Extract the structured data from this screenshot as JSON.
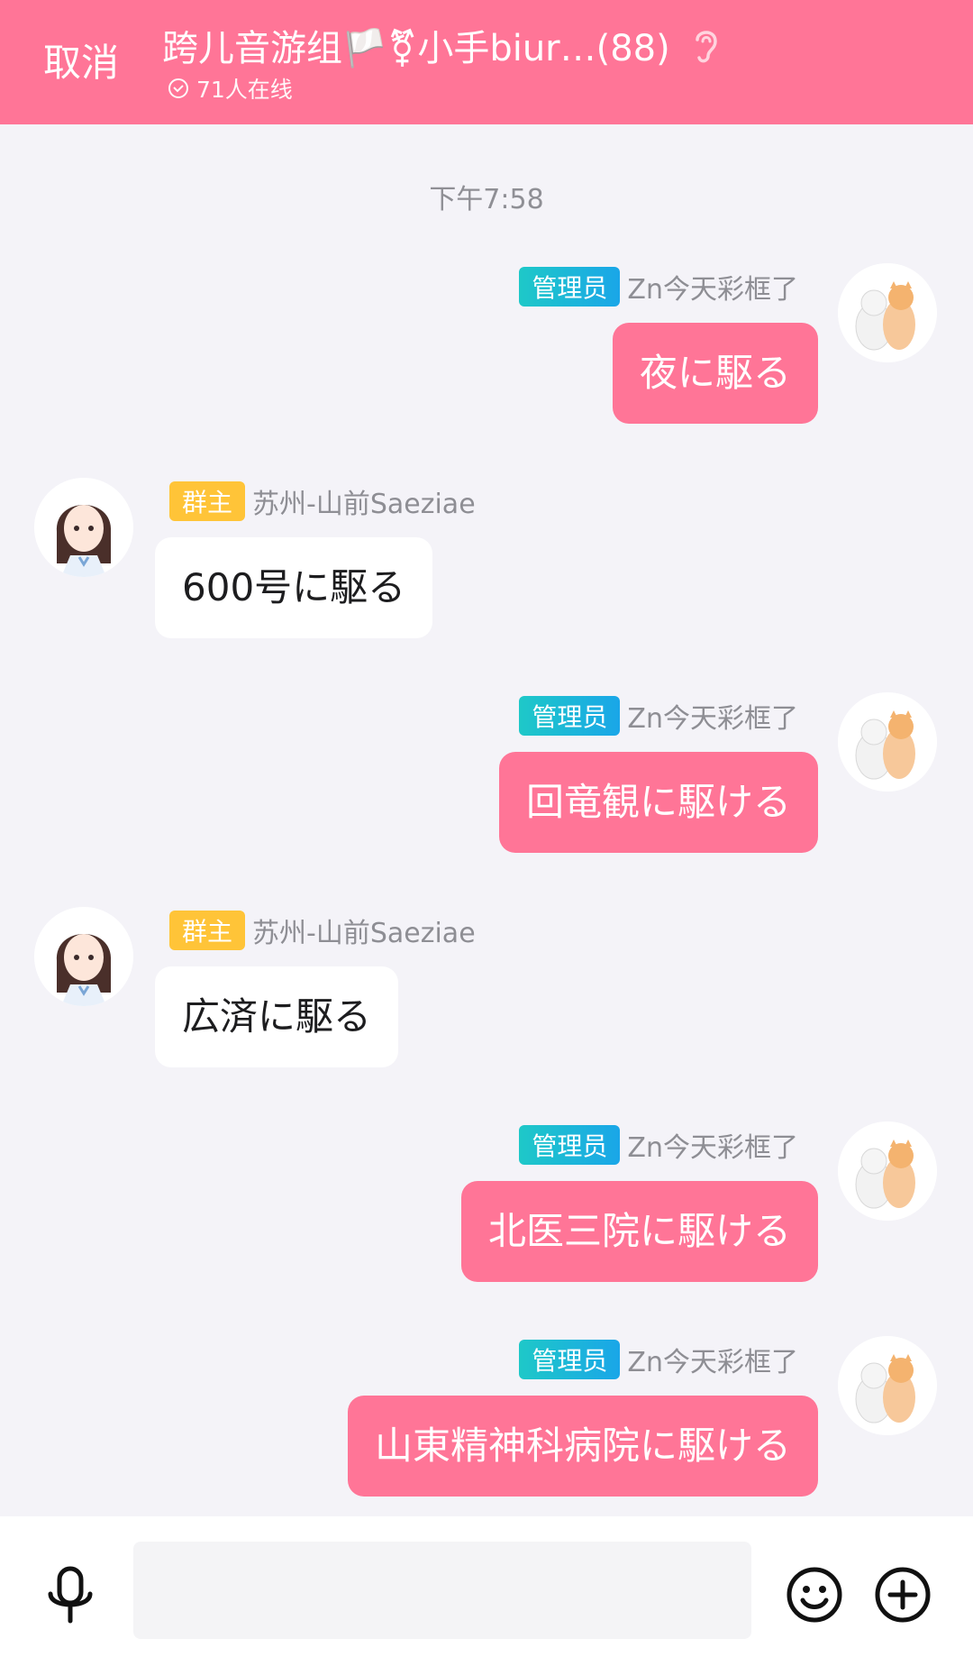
{
  "header": {
    "cancel_label": "取消",
    "title": "跨儿音游组🏳️⚧小手biur…(88)",
    "online": "71人在线"
  },
  "chat": {
    "timestamp": "下午7:58",
    "messages": [
      {
        "side": "right",
        "badge": "管理员",
        "sender": "Zn今天彩框了",
        "text": "夜に駆る"
      },
      {
        "side": "left",
        "badge": "群主",
        "sender": "苏州-山前Saeziae",
        "text": "600号に駆る"
      },
      {
        "side": "right",
        "badge": "管理员",
        "sender": "Zn今天彩框了",
        "text": "回竜観に駆ける"
      },
      {
        "side": "left",
        "badge": "群主",
        "sender": "苏州-山前Saeziae",
        "text": "広済に駆る"
      },
      {
        "side": "right",
        "badge": "管理员",
        "sender": "Zn今天彩框了",
        "text": "北医三院に駆ける"
      },
      {
        "side": "right",
        "badge": "管理员",
        "sender": "Zn今天彩框了",
        "text": "山東精神科病院に駆ける"
      }
    ]
  },
  "bottombar": {
    "input_placeholder": "",
    "icons": [
      "microphone-icon",
      "emoji-icon",
      "plus-icon"
    ]
  },
  "colors": {
    "accent": "#ff7597",
    "admin_badge": "#1ec8c8",
    "owner_badge": "#ffc438"
  }
}
